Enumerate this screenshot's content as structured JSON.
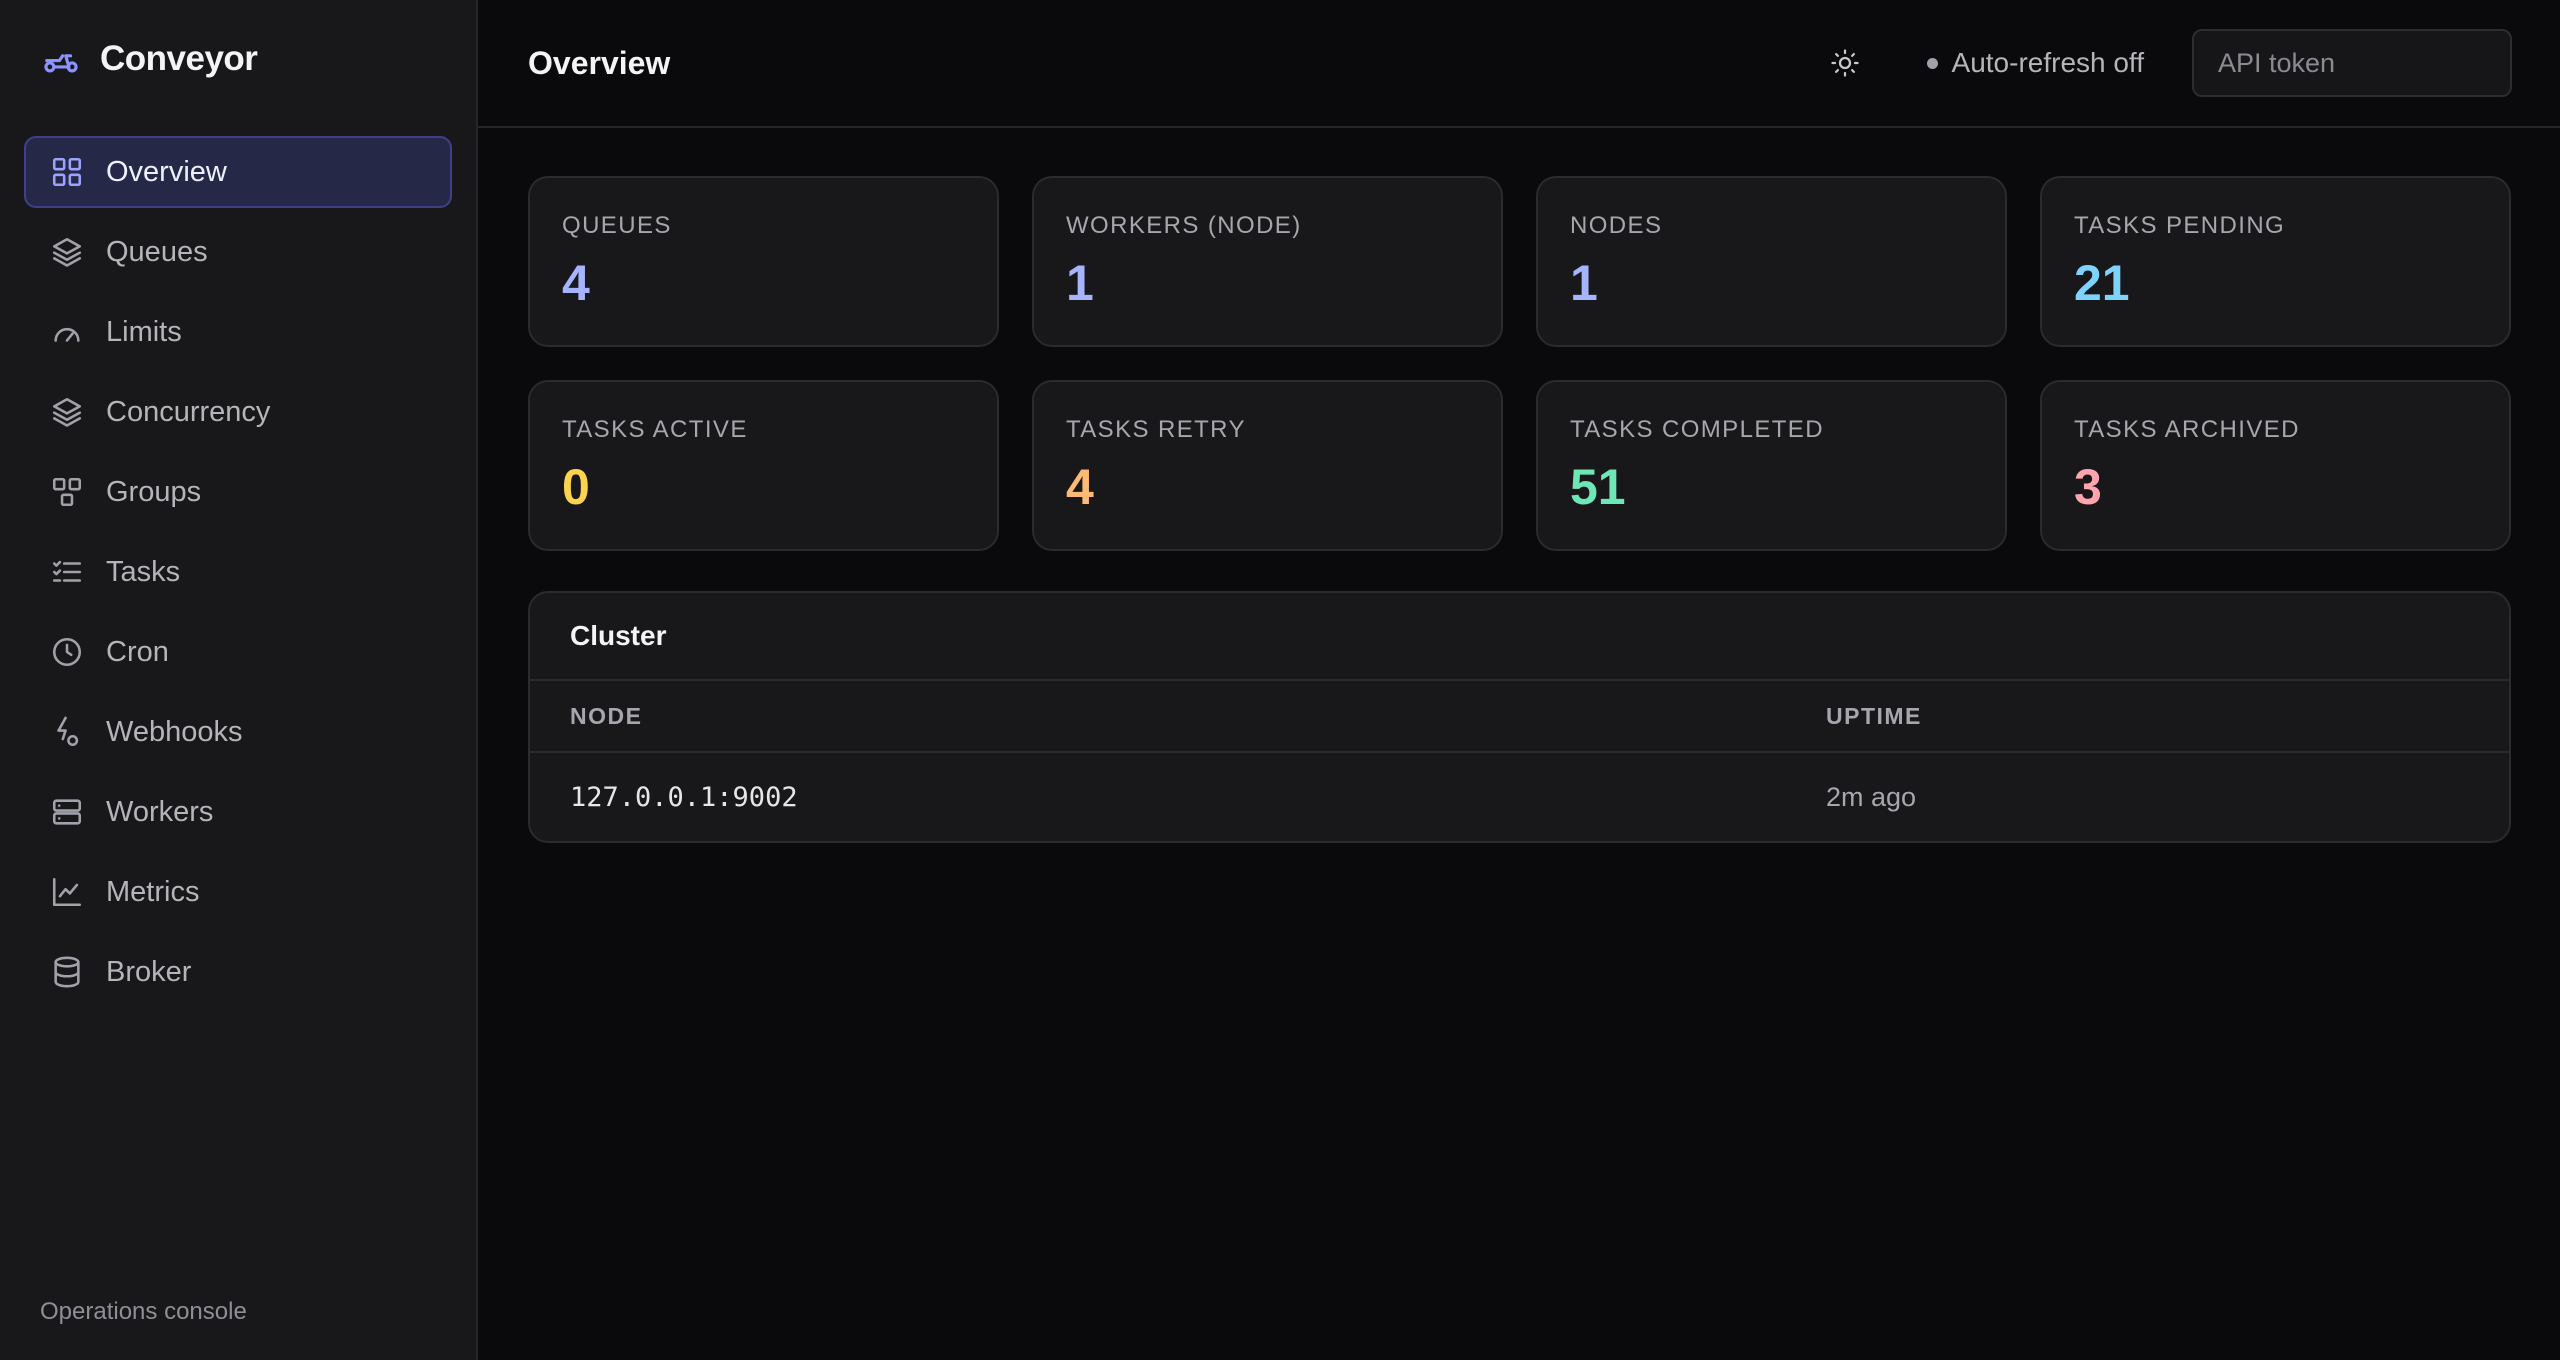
{
  "app": {
    "name": "Conveyor",
    "footer": "Operations console"
  },
  "sidebar": {
    "items": [
      {
        "label": "Overview",
        "icon": "grid-icon",
        "active": true
      },
      {
        "label": "Queues",
        "icon": "layers-icon",
        "active": false
      },
      {
        "label": "Limits",
        "icon": "gauge-icon",
        "active": false
      },
      {
        "label": "Concurrency",
        "icon": "layers-icon",
        "active": false
      },
      {
        "label": "Groups",
        "icon": "groups-icon",
        "active": false
      },
      {
        "label": "Tasks",
        "icon": "list-checks-icon",
        "active": false
      },
      {
        "label": "Cron",
        "icon": "clock-icon",
        "active": false
      },
      {
        "label": "Webhooks",
        "icon": "webhook-icon",
        "active": false
      },
      {
        "label": "Workers",
        "icon": "server-icon",
        "active": false
      },
      {
        "label": "Metrics",
        "icon": "line-chart-icon",
        "active": false
      },
      {
        "label": "Broker",
        "icon": "database-icon",
        "active": false
      }
    ]
  },
  "header": {
    "title": "Overview",
    "auto_refresh": "Auto-refresh off",
    "token_placeholder": "API token"
  },
  "stats": [
    {
      "label": "QUEUES",
      "value": "4",
      "color": "#a5b4fc"
    },
    {
      "label": "WORKERS (NODE)",
      "value": "1",
      "color": "#a5b4fc"
    },
    {
      "label": "NODES",
      "value": "1",
      "color": "#a5b4fc"
    },
    {
      "label": "TASKS PENDING",
      "value": "21",
      "color": "#7dd3fc"
    },
    {
      "label": "TASKS ACTIVE",
      "value": "0",
      "color": "#fcd34d"
    },
    {
      "label": "TASKS RETRY",
      "value": "4",
      "color": "#fdba74"
    },
    {
      "label": "TASKS COMPLETED",
      "value": "51",
      "color": "#6ee7b7"
    },
    {
      "label": "TASKS ARCHIVED",
      "value": "3",
      "color": "#fda4af"
    }
  ],
  "cluster": {
    "title": "Cluster",
    "columns": {
      "node": "NODE",
      "uptime": "UPTIME"
    },
    "rows": [
      {
        "node": "127.0.0.1:9002",
        "uptime": "2m ago"
      }
    ]
  },
  "colors": {
    "accent": "#9ca3ff",
    "active_bg": "#262847"
  }
}
